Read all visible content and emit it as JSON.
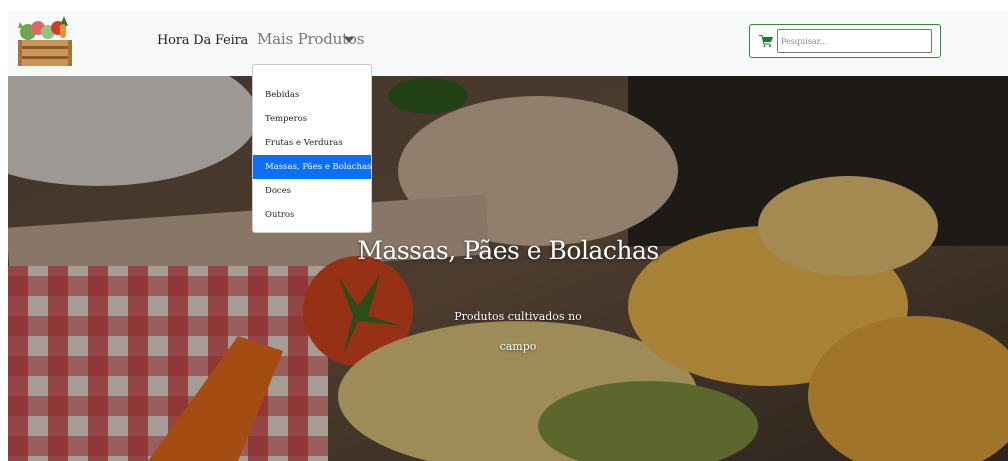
{
  "navbar": {
    "home_label": "Hora Da Feira",
    "more_label": "Mais Produtos",
    "search": {
      "placeholder": "Pesquisar..."
    }
  },
  "dropdown": {
    "items": [
      {
        "label": "Bebidas"
      },
      {
        "label": "Temperos"
      },
      {
        "label": "Frutas e Verduras"
      },
      {
        "label": "Massas, Pães e Bolachas"
      },
      {
        "label": "Doces"
      },
      {
        "label": "Outros"
      }
    ],
    "selected_index": 3
  },
  "hero": {
    "title": "Massas, Pães e Bolachas",
    "subtitle": "Produtos cultivados no campo"
  },
  "colors": {
    "accent": "#0d6efd",
    "search_border": "#2e8b3a",
    "navbar_bg": "#f8f9fa"
  },
  "icons": {
    "logo": "produce-crate-logo",
    "cart": "shopping-cart-icon",
    "caret": "caret-down-icon"
  }
}
